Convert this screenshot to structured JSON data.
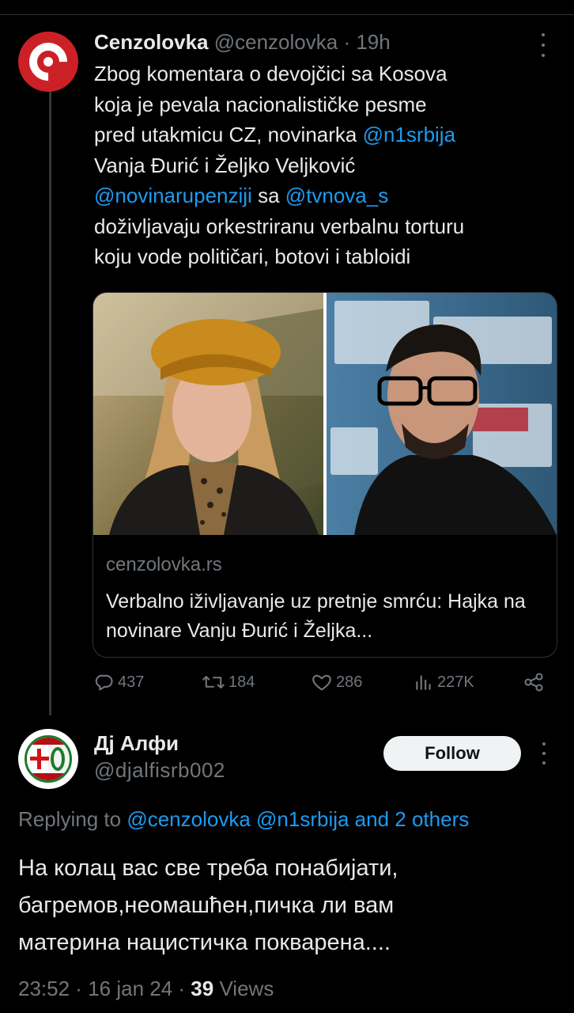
{
  "tweet1": {
    "author_name": "Cenzolovka",
    "handle": "@cenzolovka",
    "separator": " · ",
    "time": "19h",
    "text_parts": [
      "Zbog komentara o devojčici sa Kosova\nkoja je pevala nacionalističke pesme\npred utakmicu CZ, novinarka ",
      "@n1srbija",
      "\nVanja Đurić i Željko Veljković\n",
      "@novinarupenziji",
      " sa ",
      "@tvnova_s",
      "\ndoživljavaju orkestriranu verbalnu torturu\nkoju vode političari, botovi i tabloidi"
    ],
    "card": {
      "domain": "cenzolovka.rs",
      "title": "Verbalno iživljavanje uz pretnje smrću: Hajka na novinare Vanju Đurić i Željka..."
    },
    "actions": {
      "replies": "437",
      "reposts": "184",
      "likes": "286",
      "views": "227K"
    }
  },
  "tweet2": {
    "author_name": "Дј Алфи",
    "handle": "@djalfisrb002",
    "follow_label": "Follow",
    "replying_prefix": "Replying to ",
    "replying_to": "@cenzolovka @n1srbija and 2 others",
    "text": "На колац вас све треба понабијати,\nбагремов,неомашћен,пичка ли вам\nматерина нацистичка покварена....",
    "time": "23:52",
    "date": "16 jan 24",
    "views_count": "39",
    "views_label": "Views"
  },
  "colors": {
    "background": "#000000",
    "text": "#e7e9ea",
    "secondary": "#71767b",
    "link": "#1d9bf0",
    "brand_red": "#cc2027"
  }
}
